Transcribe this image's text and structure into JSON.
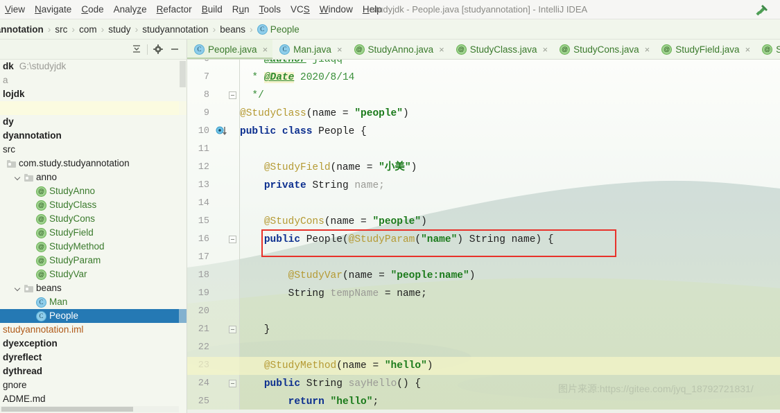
{
  "window": {
    "title": "studyjdk - People.java [studyannotation] - IntelliJ IDEA"
  },
  "menubar": {
    "items": [
      {
        "label": "View",
        "mnemonic": "V"
      },
      {
        "label": "Navigate",
        "mnemonic": "N"
      },
      {
        "label": "Code",
        "mnemonic": "C"
      },
      {
        "label": "Analyze",
        "mnemonic": "z"
      },
      {
        "label": "Refactor",
        "mnemonic": "R"
      },
      {
        "label": "Build",
        "mnemonic": "B"
      },
      {
        "label": "Run",
        "mnemonic": "u"
      },
      {
        "label": "Tools",
        "mnemonic": "T"
      },
      {
        "label": "VCS",
        "mnemonic": "S"
      },
      {
        "label": "Window",
        "mnemonic": "W"
      },
      {
        "label": "Help",
        "mnemonic": "H"
      }
    ]
  },
  "breadcrumb": {
    "items": [
      {
        "label": "dyannotation",
        "icon": "none",
        "style": "first"
      },
      {
        "label": "src",
        "icon": "none",
        "style": "plain"
      },
      {
        "label": "com",
        "icon": "none",
        "style": "plain"
      },
      {
        "label": "study",
        "icon": "none",
        "style": "plain"
      },
      {
        "label": "studyannotation",
        "icon": "none",
        "style": "plain"
      },
      {
        "label": "beans",
        "icon": "none",
        "style": "plain"
      },
      {
        "label": "People",
        "icon": "class-icon",
        "style": "leaf"
      }
    ],
    "separator": "›",
    "build_icon": "hammer-icon"
  },
  "sidebar": {
    "toolbar": {
      "collapse_all": "collapse-all-icon",
      "settings": "gear-icon",
      "hide": "minimize-icon"
    },
    "rows": [
      {
        "indent": 0,
        "label": "dk",
        "extra": "G:\\studyjdk",
        "style": "bold",
        "icon": "none",
        "chev": false
      },
      {
        "indent": 0,
        "label": "a",
        "extra": "",
        "style": "grey",
        "icon": "none",
        "chev": false
      },
      {
        "indent": 0,
        "label": "lojdk",
        "extra": "",
        "style": "bold",
        "icon": "none",
        "chev": false
      },
      {
        "indent": 0,
        "label": "",
        "extra": "",
        "style": "plain",
        "icon": "none",
        "chev": false,
        "highlight": true
      },
      {
        "indent": 0,
        "label": "dy",
        "extra": "",
        "style": "bold",
        "icon": "none",
        "chev": false
      },
      {
        "indent": 0,
        "label": "dyannotation",
        "extra": "",
        "style": "bold",
        "icon": "none",
        "chev": false
      },
      {
        "indent": 0,
        "label": "src",
        "extra": "",
        "style": "plain",
        "icon": "none",
        "chev": false
      },
      {
        "indent": 10,
        "label": "com.study.studyannotation",
        "extra": "",
        "style": "plain",
        "icon": "folder-icon",
        "chev": false
      },
      {
        "indent": 22,
        "label": "anno",
        "extra": "",
        "style": "plain",
        "icon": "folder-icon",
        "chev": true
      },
      {
        "indent": 52,
        "label": "StudyAnno",
        "extra": "",
        "style": "green",
        "icon": "annotation-icon",
        "chev": false
      },
      {
        "indent": 52,
        "label": "StudyClass",
        "extra": "",
        "style": "green",
        "icon": "annotation-icon",
        "chev": false
      },
      {
        "indent": 52,
        "label": "StudyCons",
        "extra": "",
        "style": "green",
        "icon": "annotation-icon",
        "chev": false
      },
      {
        "indent": 52,
        "label": "StudyField",
        "extra": "",
        "style": "green",
        "icon": "annotation-icon",
        "chev": false
      },
      {
        "indent": 52,
        "label": "StudyMethod",
        "extra": "",
        "style": "green",
        "icon": "annotation-icon",
        "chev": false
      },
      {
        "indent": 52,
        "label": "StudyParam",
        "extra": "",
        "style": "green",
        "icon": "annotation-icon",
        "chev": false
      },
      {
        "indent": 52,
        "label": "StudyVar",
        "extra": "",
        "style": "green",
        "icon": "annotation-icon",
        "chev": false
      },
      {
        "indent": 22,
        "label": "beans",
        "extra": "",
        "style": "plain",
        "icon": "folder-icon",
        "chev": true
      },
      {
        "indent": 52,
        "label": "Man",
        "extra": "",
        "style": "green",
        "icon": "class-icon",
        "chev": false
      },
      {
        "indent": 52,
        "label": "People",
        "extra": "",
        "style": "green",
        "icon": "class-icon",
        "chev": false,
        "selected": true
      },
      {
        "indent": 0,
        "label": "studyannotation.iml",
        "extra": "",
        "style": "orange",
        "icon": "none",
        "chev": false
      },
      {
        "indent": 0,
        "label": "dyexception",
        "extra": "",
        "style": "bold",
        "icon": "none",
        "chev": false
      },
      {
        "indent": 0,
        "label": "dyreflect",
        "extra": "",
        "style": "bold",
        "icon": "none",
        "chev": false
      },
      {
        "indent": 0,
        "label": "dythread",
        "extra": "",
        "style": "bold",
        "icon": "none",
        "chev": false
      },
      {
        "indent": 0,
        "label": "gnore",
        "extra": "",
        "style": "plain",
        "icon": "none",
        "chev": false
      },
      {
        "indent": 0,
        "label": "ADME.md",
        "extra": "",
        "style": "plain",
        "icon": "none",
        "chev": false
      }
    ]
  },
  "editor_tabs": [
    {
      "label": "People.java",
      "icon": "class-icon",
      "active": true,
      "close": "×"
    },
    {
      "label": "Man.java",
      "icon": "class-icon",
      "active": false,
      "close": "×"
    },
    {
      "label": "StudyAnno.java",
      "icon": "annotation-icon",
      "active": false,
      "close": "×"
    },
    {
      "label": "StudyClass.java",
      "icon": "annotation-icon",
      "active": false,
      "close": "×"
    },
    {
      "label": "StudyCons.java",
      "icon": "annotation-icon",
      "active": false,
      "close": "×"
    },
    {
      "label": "StudyField.java",
      "icon": "annotation-icon",
      "active": false,
      "close": "×"
    },
    {
      "label": "StudyMetho",
      "icon": "annotation-icon",
      "active": false,
      "close": ""
    }
  ],
  "editor": {
    "first_visible_line": 6,
    "highlighted_line": 23,
    "gutter_marker_line": 10,
    "fold_lines": [
      8,
      16,
      21,
      24
    ],
    "lines": [
      {
        "n": 6,
        "tokens": [
          {
            "t": "  * ",
            "c": "t-cmt"
          },
          {
            "t": "@author",
            "c": "t-tag"
          },
          {
            "t": " jiaqq",
            "c": "t-cmt"
          }
        ]
      },
      {
        "n": 7,
        "tokens": [
          {
            "t": "  * ",
            "c": "t-cmt"
          },
          {
            "t": "@Date",
            "c": "t-tag t-tagbg"
          },
          {
            "t": " 2020/8/14",
            "c": "t-cmt"
          }
        ]
      },
      {
        "n": 8,
        "tokens": [
          {
            "t": "  */",
            "c": "t-cmt"
          }
        ]
      },
      {
        "n": 9,
        "tokens": [
          {
            "t": "@StudyClass",
            "c": "t-ann"
          },
          {
            "t": "(name = ",
            "c": "t-txt"
          },
          {
            "t": "\"people\"",
            "c": "t-str"
          },
          {
            "t": ")",
            "c": "t-txt"
          }
        ]
      },
      {
        "n": 10,
        "tokens": [
          {
            "t": "public class ",
            "c": "t-kw"
          },
          {
            "t": "People {",
            "c": "t-txt"
          }
        ]
      },
      {
        "n": 11,
        "tokens": []
      },
      {
        "n": 12,
        "tokens": [
          {
            "t": "    ",
            "c": "t-txt"
          },
          {
            "t": "@StudyField",
            "c": "t-ann"
          },
          {
            "t": "(name = ",
            "c": "t-txt"
          },
          {
            "t": "\"小美\"",
            "c": "t-str"
          },
          {
            "t": ")",
            "c": "t-txt"
          }
        ]
      },
      {
        "n": 13,
        "tokens": [
          {
            "t": "    ",
            "c": "t-txt"
          },
          {
            "t": "private ",
            "c": "t-kw"
          },
          {
            "t": "String ",
            "c": "t-txt"
          },
          {
            "t": "name;",
            "c": "t-fld"
          }
        ]
      },
      {
        "n": 14,
        "tokens": []
      },
      {
        "n": 15,
        "tokens": [
          {
            "t": "    ",
            "c": "t-txt"
          },
          {
            "t": "@StudyCons",
            "c": "t-ann"
          },
          {
            "t": "(name = ",
            "c": "t-txt"
          },
          {
            "t": "\"people\"",
            "c": "t-str"
          },
          {
            "t": ")",
            "c": "t-txt"
          }
        ]
      },
      {
        "n": 16,
        "tokens": [
          {
            "t": "    ",
            "c": "t-txt"
          },
          {
            "t": "public ",
            "c": "t-kw"
          },
          {
            "t": "People(",
            "c": "t-txt"
          },
          {
            "t": "@StudyParam",
            "c": "t-ann"
          },
          {
            "t": "(",
            "c": "t-txt"
          },
          {
            "t": "\"name\"",
            "c": "t-str"
          },
          {
            "t": ") String name) {",
            "c": "t-txt"
          }
        ]
      },
      {
        "n": 17,
        "tokens": []
      },
      {
        "n": 18,
        "tokens": [
          {
            "t": "        ",
            "c": "t-txt"
          },
          {
            "t": "@StudyVar",
            "c": "t-ann"
          },
          {
            "t": "(name = ",
            "c": "t-txt"
          },
          {
            "t": "\"people:name\"",
            "c": "t-str"
          },
          {
            "t": ")",
            "c": "t-txt"
          }
        ]
      },
      {
        "n": 19,
        "tokens": [
          {
            "t": "        String ",
            "c": "t-txt"
          },
          {
            "t": "tempName",
            "c": "t-fld"
          },
          {
            "t": " = name;",
            "c": "t-txt"
          }
        ]
      },
      {
        "n": 20,
        "tokens": []
      },
      {
        "n": 21,
        "tokens": [
          {
            "t": "    }",
            "c": "t-txt"
          }
        ]
      },
      {
        "n": 22,
        "tokens": []
      },
      {
        "n": 23,
        "tokens": [
          {
            "t": "    ",
            "c": "t-txt"
          },
          {
            "t": "@StudyMethod",
            "c": "t-ann"
          },
          {
            "t": "(name = ",
            "c": "t-txt"
          },
          {
            "t": "\"hello\"",
            "c": "t-str"
          },
          {
            "t": ")",
            "c": "t-txt"
          }
        ]
      },
      {
        "n": 24,
        "tokens": [
          {
            "t": "    ",
            "c": "t-txt"
          },
          {
            "t": "public ",
            "c": "t-kw"
          },
          {
            "t": "String ",
            "c": "t-txt"
          },
          {
            "t": "sayHello",
            "c": "t-fld"
          },
          {
            "t": "() {",
            "c": "t-txt"
          }
        ]
      },
      {
        "n": 25,
        "tokens": [
          {
            "t": "        ",
            "c": "t-txt"
          },
          {
            "t": "return ",
            "c": "t-kw"
          },
          {
            "t": "\"hello\"",
            "c": "t-str"
          },
          {
            "t": ";",
            "c": "t-txt"
          }
        ]
      }
    ],
    "annotation_box": {
      "line": 16,
      "color": "#e8312a"
    }
  },
  "watermark": {
    "text": "图片来源:https://gitee.com/jyq_18792721831/"
  },
  "colors": {
    "selection_blue": "#2579b4",
    "annotation_gold": "#b59a33",
    "string_green": "#1a7a1a",
    "keyword_blue": "#0c2f8f",
    "comment_green": "#3a8f3a",
    "red_box": "#e8312a"
  }
}
